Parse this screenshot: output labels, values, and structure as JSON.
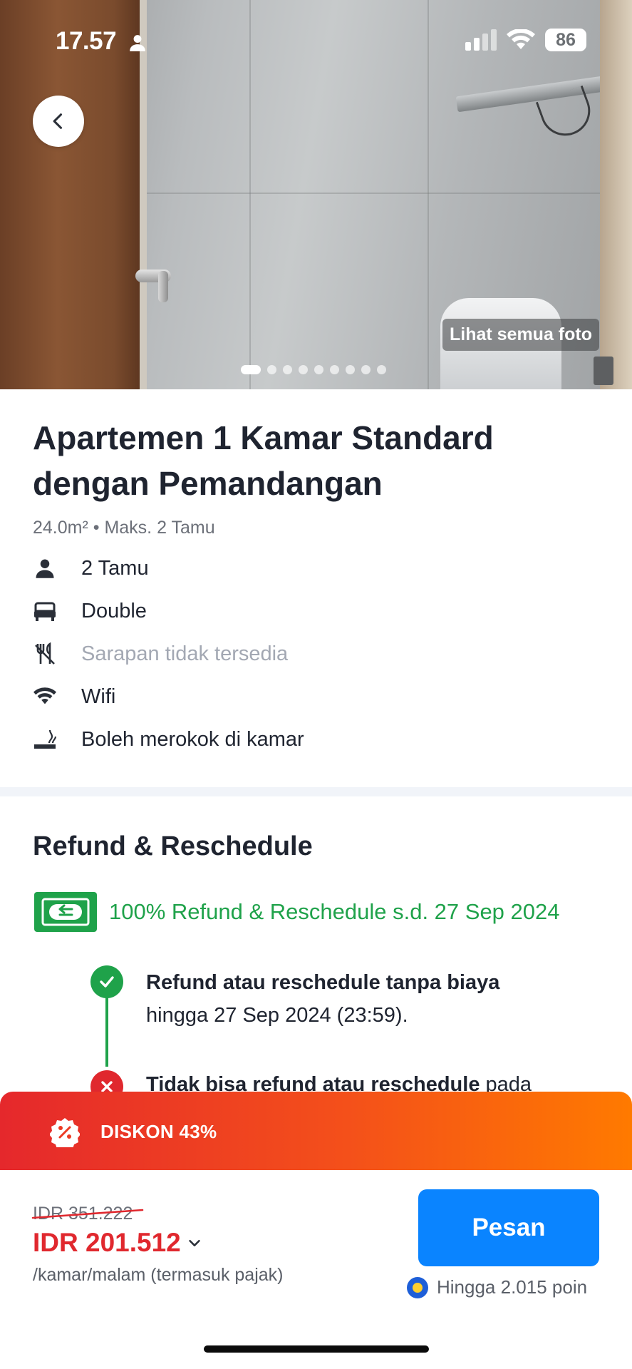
{
  "status_bar": {
    "time": "17.57",
    "battery": "86",
    "icons": [
      "person-icon",
      "cellular-signal-icon",
      "wifi-icon",
      "battery-icon"
    ]
  },
  "hero": {
    "see_all_label": "Lihat semua foto",
    "photo_count": 9,
    "active_photo_index": 0,
    "back_icon": "chevron-left-icon"
  },
  "room": {
    "title": "Apartemen 1 Kamar Standard dengan Pemandangan",
    "subtitle": "24.0m² • Maks. 2 Tamu",
    "features": [
      {
        "icon": "person-icon",
        "label": "2 Tamu",
        "available": true
      },
      {
        "icon": "bed-icon",
        "label": "Double",
        "available": true
      },
      {
        "icon": "no-breakfast-icon",
        "label": "Sarapan tidak tersedia",
        "available": false
      },
      {
        "icon": "wifi-icon",
        "label": "Wifi",
        "available": true
      },
      {
        "icon": "smoking-icon",
        "label": "Boleh merokok di kamar",
        "available": true
      }
    ]
  },
  "refund": {
    "section_title": "Refund & Reschedule",
    "badge_text": "100% Refund & Reschedule s.d. 27 Sep 2024",
    "timeline": [
      {
        "status": "allowed",
        "bold": "Refund atau reschedule tanpa biaya",
        "rest": "hingga 27 Sep 2024 (23:59)."
      },
      {
        "status": "not-allowed",
        "bold": "Tidak bisa refund atau reschedule",
        "rest": " pada"
      }
    ]
  },
  "discount": {
    "label": "DISKON 43%"
  },
  "booking": {
    "original_price": "IDR 351.222",
    "price": "IDR 201.512",
    "per_night": "/kamar/malam (termasuk pajak)",
    "book_label": "Pesan",
    "points_text": "Hingga 2.015 poin"
  },
  "colors": {
    "primary_blue": "#0a84ff",
    "price_red": "#e0282e",
    "refund_green": "#1fa24a",
    "discount_gradient": [
      "#e5282c",
      "#ff7a00"
    ],
    "muted_text": "#a3a8b3"
  }
}
